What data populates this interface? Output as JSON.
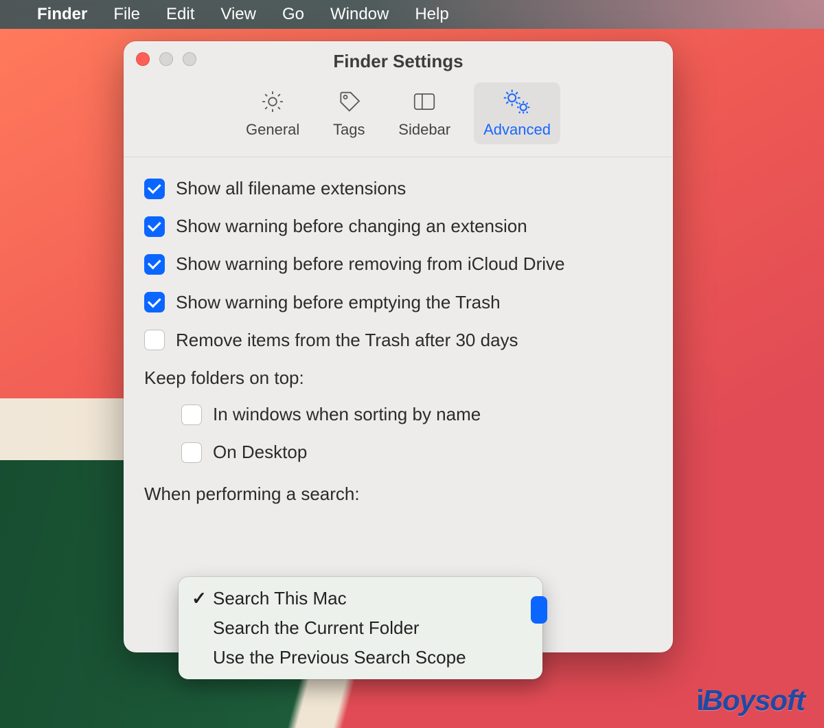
{
  "menubar": {
    "app": "Finder",
    "items": [
      "File",
      "Edit",
      "View",
      "Go",
      "Window",
      "Help"
    ]
  },
  "window": {
    "title": "Finder Settings",
    "tabs": [
      {
        "id": "general",
        "label": "General",
        "icon": "gear-icon",
        "active": false
      },
      {
        "id": "tags",
        "label": "Tags",
        "icon": "tag-icon",
        "active": false
      },
      {
        "id": "sidebar",
        "label": "Sidebar",
        "icon": "sidebar-icon",
        "active": false
      },
      {
        "id": "advanced",
        "label": "Advanced",
        "icon": "gears-icon",
        "active": true
      }
    ],
    "checkboxes": [
      {
        "label": "Show all filename extensions",
        "checked": true
      },
      {
        "label": "Show warning before changing an extension",
        "checked": true
      },
      {
        "label": "Show warning before removing from iCloud Drive",
        "checked": true
      },
      {
        "label": "Show warning before emptying the Trash",
        "checked": true
      },
      {
        "label": "Remove items from the Trash after 30 days",
        "checked": false
      }
    ],
    "keep_folders_label": "Keep folders on top:",
    "keep_folders": [
      {
        "label": "In windows when sorting by name",
        "checked": false
      },
      {
        "label": "On Desktop",
        "checked": false
      }
    ],
    "search_label": "When performing a search:",
    "search_options": [
      {
        "label": "Search This Mac",
        "selected": true
      },
      {
        "label": "Search the Current Folder",
        "selected": false
      },
      {
        "label": "Use the Previous Search Scope",
        "selected": false
      }
    ]
  },
  "watermark": "iBoysoft"
}
